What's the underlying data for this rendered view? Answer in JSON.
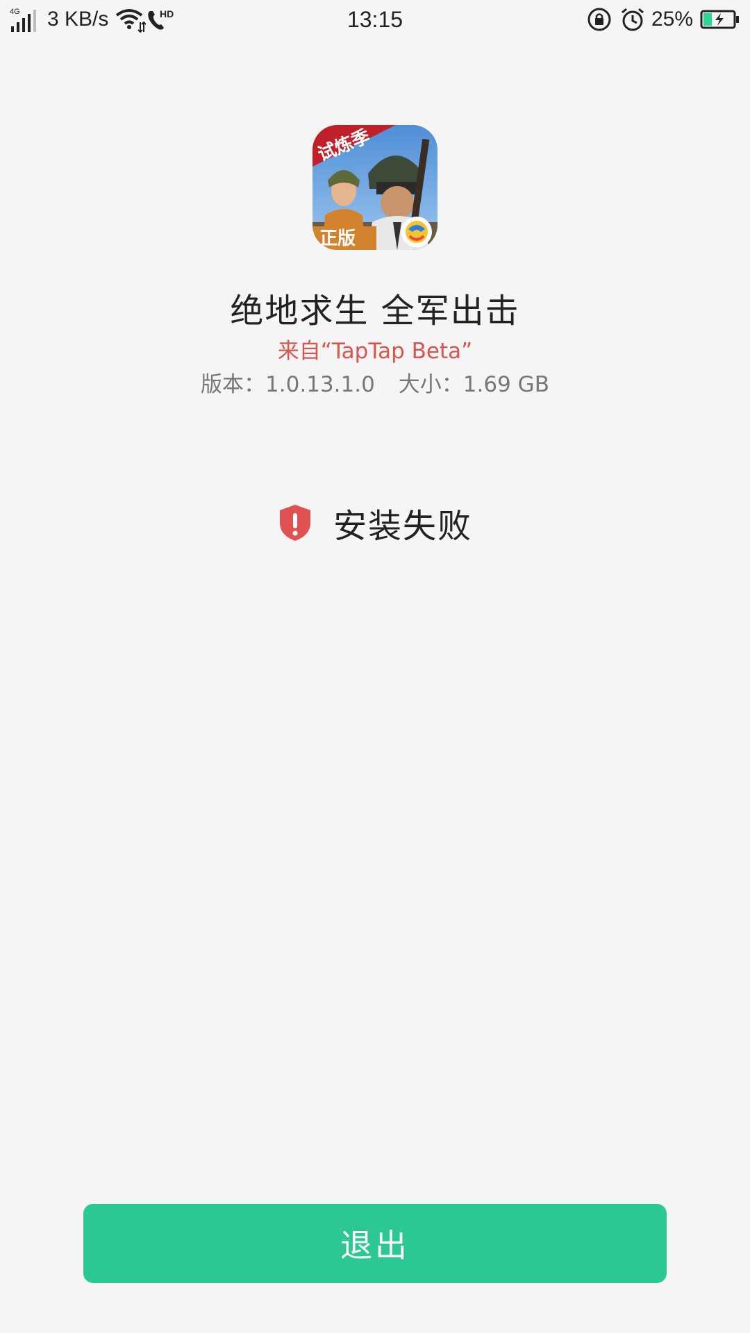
{
  "status_bar": {
    "network_type": "4G",
    "net_speed": "3 KB/s",
    "hd_label": "HD",
    "time": "13:15",
    "battery_percent": "25%",
    "battery_level": 0.25,
    "battery_color": "#2bd68f"
  },
  "app": {
    "icon_badge_top": "试炼季",
    "icon_badge_bottom": "正版",
    "name": "绝地求生 全军出击",
    "source": "来自“TapTap Beta”",
    "version": "版本：1.0.13.1.0",
    "size": "大小：1.69 GB"
  },
  "install": {
    "status": "安装失败",
    "status_icon": "shield-alert-icon",
    "status_color": "#e05252"
  },
  "actions": {
    "exit_label": "退出",
    "exit_color": "#2bc894"
  }
}
